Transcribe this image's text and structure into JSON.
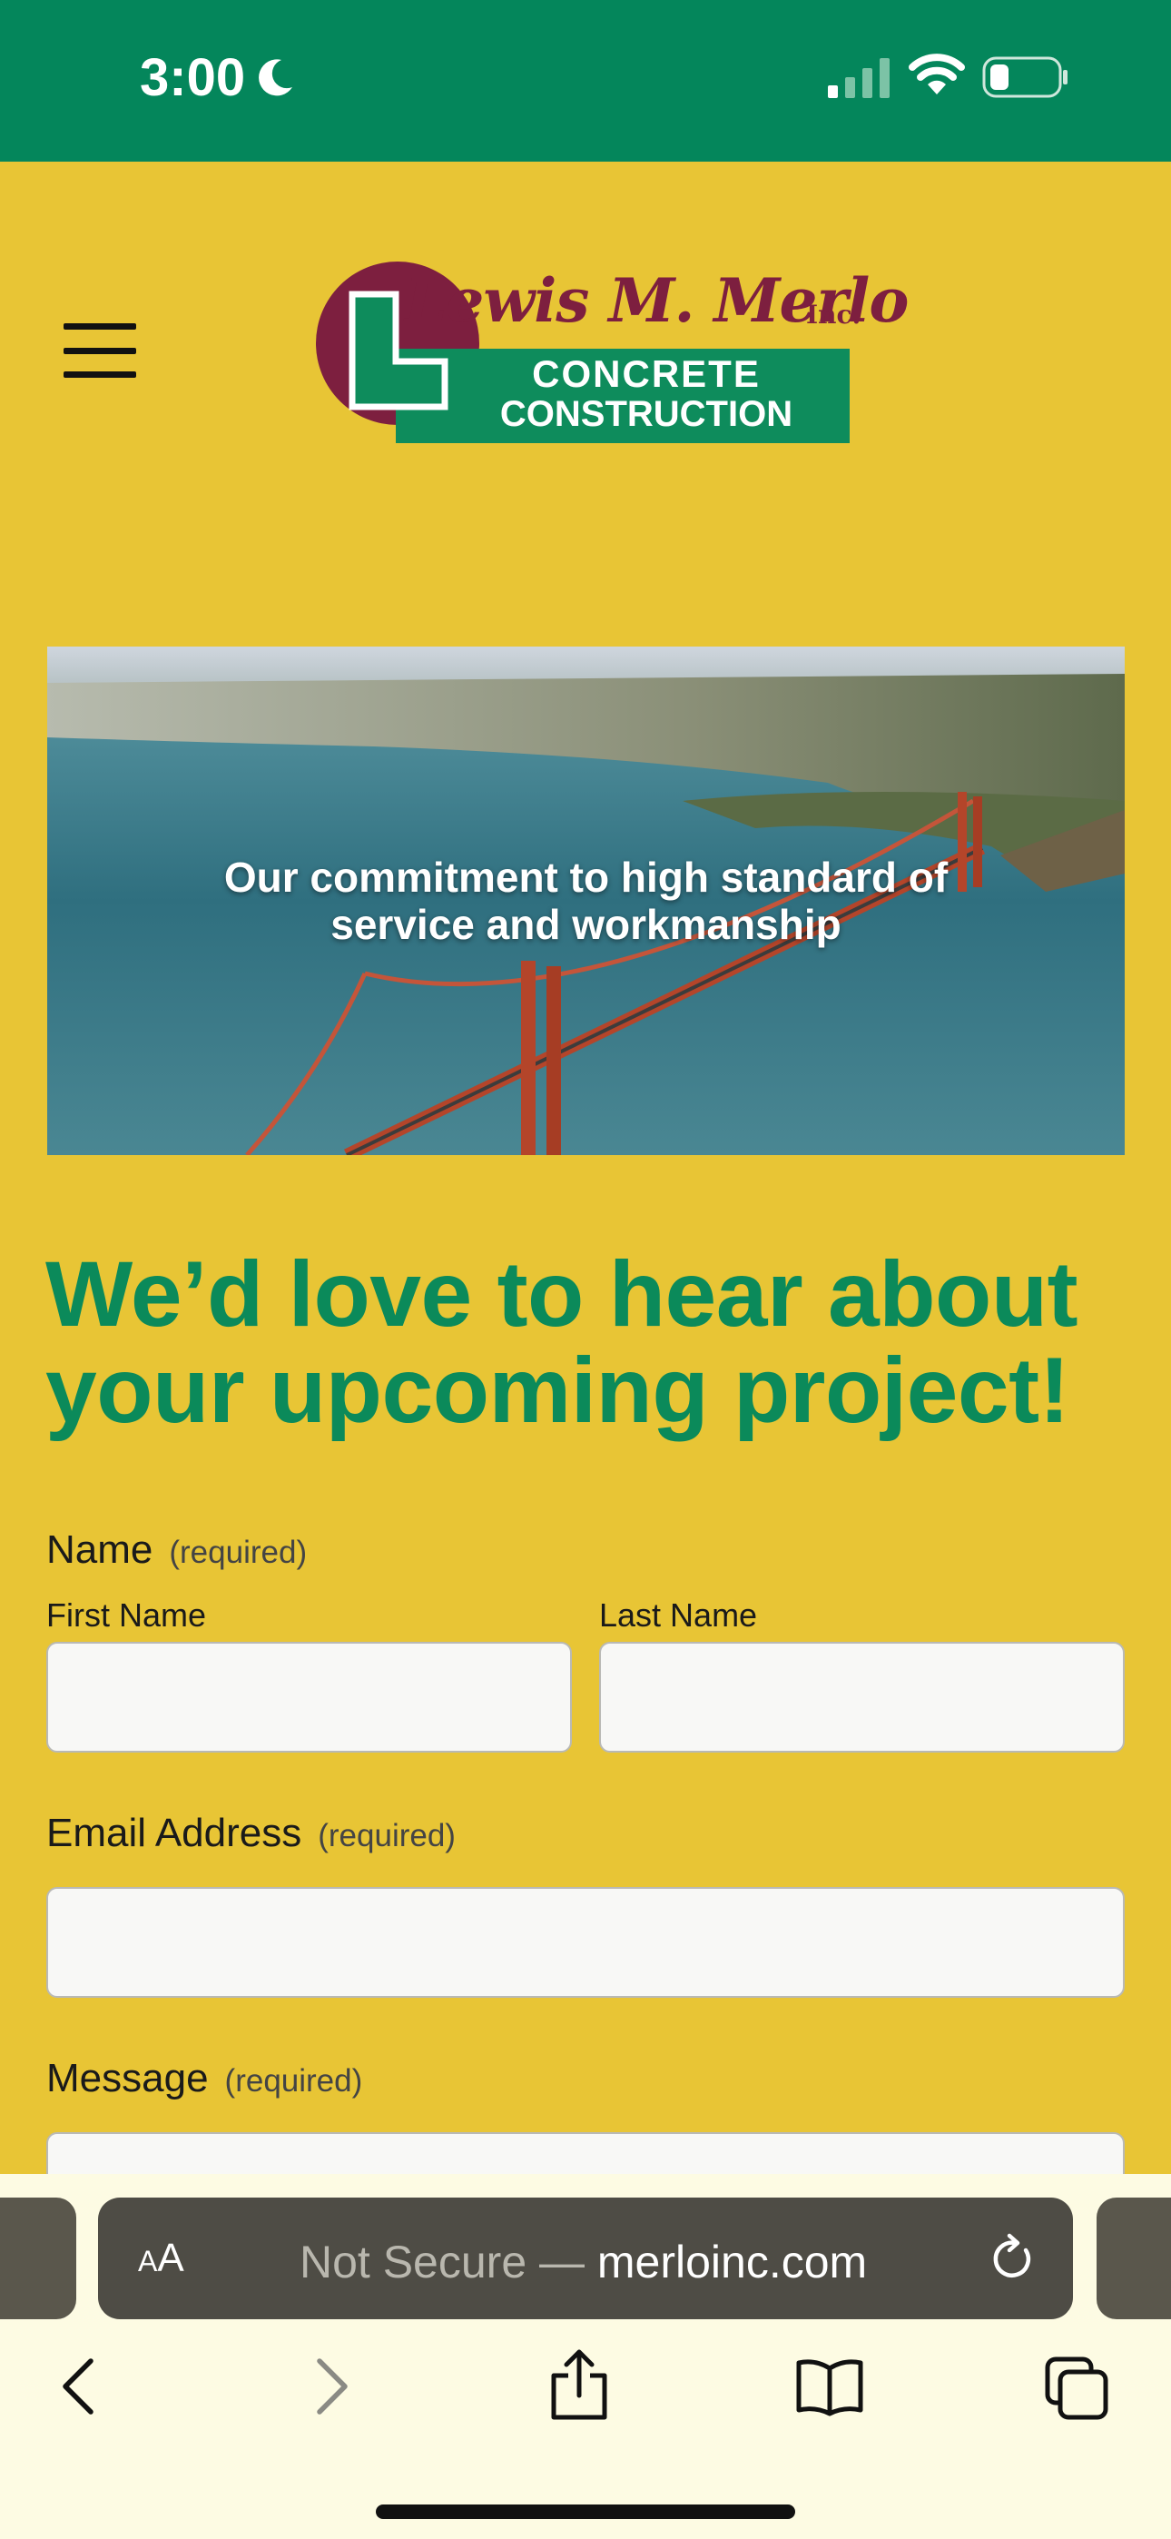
{
  "status_bar": {
    "time": "3:00",
    "colors": {
      "background": "#04865b"
    }
  },
  "header": {
    "menu_icon": "hamburger-icon",
    "logo": {
      "name_line": "Lewis M. Merlo",
      "suffix": "Inc.",
      "line1": "CONCRETE",
      "line2": "CONSTRUCTION"
    }
  },
  "hero": {
    "caption": "Our commitment to high standard of service and workmanship"
  },
  "main": {
    "heading": "We’d love to hear about your upcoming project!"
  },
  "form": {
    "name": {
      "label": "Name",
      "required": "(required)",
      "first_label": "First Name",
      "last_label": "Last Name",
      "first_value": "",
      "last_value": ""
    },
    "email": {
      "label": "Email Address",
      "required": "(required)",
      "value": ""
    },
    "message": {
      "label": "Message",
      "required": "(required)",
      "value": ""
    }
  },
  "browser": {
    "aa_label_small": "A",
    "aa_label_large": "A",
    "url_prefix": "Not Secure — ",
    "url_domain": "merloinc.com",
    "icons": [
      "back-icon",
      "forward-icon",
      "share-icon",
      "bookmarks-icon",
      "tabs-icon",
      "reload-icon"
    ]
  },
  "colors": {
    "page_background": "#e8c535",
    "heading_green": "#0b8a5a",
    "logo_maroon": "#7d1f3f",
    "logo_green": "#0e8c5c"
  }
}
